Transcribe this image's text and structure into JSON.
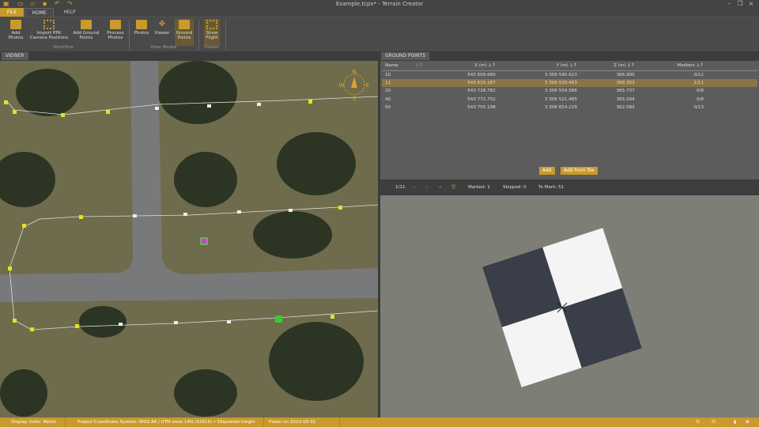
{
  "window": {
    "title": "Example.tcpx* - Terrain Creator",
    "controls": [
      "minimize",
      "restore",
      "close"
    ]
  },
  "quick_access": [
    "app-icon",
    "new-project-icon",
    "open-icon",
    "save-icon",
    "undo-icon",
    "redo-icon"
  ],
  "tabs": [
    {
      "label": "FILE"
    },
    {
      "label": "HOME",
      "active": true
    },
    {
      "label": "HELP"
    }
  ],
  "ribbon": {
    "buttons": [
      {
        "label": "Add\nPhotos",
        "group": "Workflow"
      },
      {
        "label": "Import PPK\nCamera Positions",
        "group": "Workflow"
      },
      {
        "label": "Add Ground\nPoints",
        "group": "Workflow"
      },
      {
        "label": "Process\nPhotos",
        "group": "Workflow"
      },
      {
        "label": "Photos",
        "group": "View Modes"
      },
      {
        "label": "Viewer",
        "group": "View Modes"
      },
      {
        "label": "Ground\nPoints",
        "group": "View Modes",
        "active": true
      },
      {
        "label": "Show\nFlight",
        "group": "Viewer",
        "active": true
      }
    ],
    "groups": [
      "Workflow",
      "View Modes",
      "Viewer"
    ]
  },
  "viewer": {
    "tab": "VIEWER",
    "compass": [
      "N",
      "E",
      "S",
      "W"
    ]
  },
  "ground_points": {
    "tab": "GROUND POINTS",
    "columns": [
      "Name",
      "X (m)",
      "Y (m)",
      "Z (m)",
      "Markers"
    ],
    "rows": [
      [
        "10",
        "543 609.680",
        "3 306 590.623",
        "366.900",
        "0/12"
      ],
      [
        "11",
        "543 615.187",
        "3 306 526.463",
        "368.353",
        "1/11"
      ],
      [
        "20",
        "543 718.782",
        "3 306 559.586",
        "365.737",
        "0/8"
      ],
      [
        "40",
        "543 772.752",
        "3 306 521.485",
        "365.504",
        "0/8"
      ],
      [
        "50",
        "543 755.198",
        "3 306 654.229",
        "362.083",
        "0/13"
      ]
    ],
    "selected_row": 1,
    "add": "Add",
    "add_from_file": "Add from file"
  },
  "marker_toolbar": {
    "position": "1/11",
    "marked": "Marked: 1",
    "skipped": "Skipped: 0",
    "to_mark": "To Mark: 51"
  },
  "status": {
    "units": "Display Units: Metric",
    "crs": "Project Coordinate System:  WGS 84 / UTM zone 14N (32614)  •  Ellipsoidal height",
    "flown": "Flown on 2023-03-31"
  },
  "colors": {
    "accent": "#c99a2c",
    "selected_row": "#8a7448"
  }
}
